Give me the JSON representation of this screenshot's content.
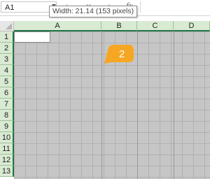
{
  "formula_bar": {
    "name_box_value": "A1",
    "fx_label": "fx",
    "cancel_glyph": "✕",
    "enter_glyph": "✓",
    "tooltip": "Width: 21.14 (153 pixels)"
  },
  "columns": [
    "A",
    "B",
    "C",
    "D"
  ],
  "rows": [
    "1",
    "2",
    "3",
    "4",
    "5",
    "6",
    "7",
    "8",
    "9",
    "10",
    "11",
    "12",
    "13"
  ],
  "selected_cell": "A1",
  "callout": {
    "step_number": "2",
    "color": "#f5a623"
  },
  "colors": {
    "header_highlight": "#d9ead3",
    "header_accent": "#217346",
    "selected_range_fill": "#c6c6c6"
  }
}
